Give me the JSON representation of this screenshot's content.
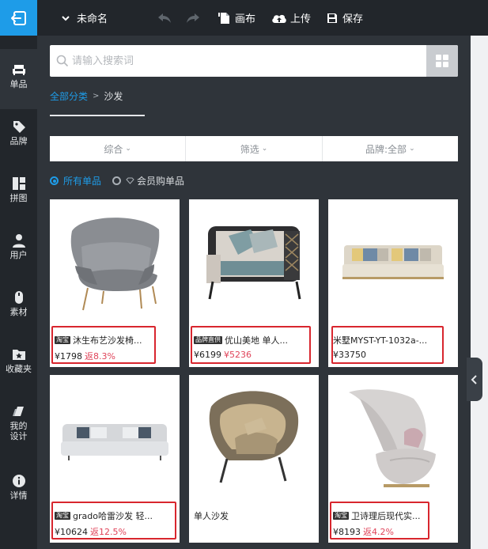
{
  "colors": {
    "accent": "#1e9ce8",
    "rail": "#22262b",
    "panel": "#2f343a",
    "highlight": "#d8262e",
    "rebate": "#e0445a"
  },
  "rail": [
    {
      "label": "单品",
      "icon": "sofa-icon",
      "active": true
    },
    {
      "label": "品牌",
      "icon": "tag-icon"
    },
    {
      "label": "拼图",
      "icon": "layout-icon"
    },
    {
      "label": "用户",
      "icon": "user-icon"
    },
    {
      "label": "素材",
      "icon": "mouse-icon"
    },
    {
      "label": "收藏夹",
      "icon": "star-folder-icon"
    },
    {
      "label": "我的设计",
      "icon": "design-icon"
    },
    {
      "label": "详情",
      "icon": "info-icon"
    }
  ],
  "topbar": {
    "title": "未命名",
    "canvas": "画布",
    "upload": "上传",
    "save": "保存"
  },
  "search": {
    "placeholder": "请输入搜索词"
  },
  "breadcrumb": {
    "root": "全部分类",
    "sep": ">",
    "current": "沙发"
  },
  "filters": [
    {
      "label": "综合"
    },
    {
      "label": "筛选"
    },
    {
      "label": "品牌:全部"
    }
  ],
  "radios": {
    "all": "所有单品",
    "member": "会员购单品"
  },
  "products": [
    {
      "tag": "淘宝",
      "name": "沐生布艺沙发椅...",
      "price": "¥1798",
      "sub": "返8.3%",
      "highlight": true
    },
    {
      "tag": "品牌直供",
      "name": "优山美地 单人...",
      "price": "¥6199",
      "sub": "¥5236",
      "highlight": true
    },
    {
      "tag": "",
      "name": "米墅MYST-YT-1032a-...",
      "price": "¥33750",
      "sub": "",
      "highlight": true
    },
    {
      "tag": "淘宝",
      "name": "grado哈雷沙发 轻...",
      "price": "¥10624",
      "sub": "返12.5%",
      "highlight": true
    },
    {
      "tag": "",
      "name": "单人沙发",
      "price": "",
      "sub": "",
      "highlight": false
    },
    {
      "tag": "淘宝",
      "name": "卫诗理后现代实...",
      "price": "¥8193",
      "sub": "返4.2%",
      "highlight": true
    }
  ]
}
